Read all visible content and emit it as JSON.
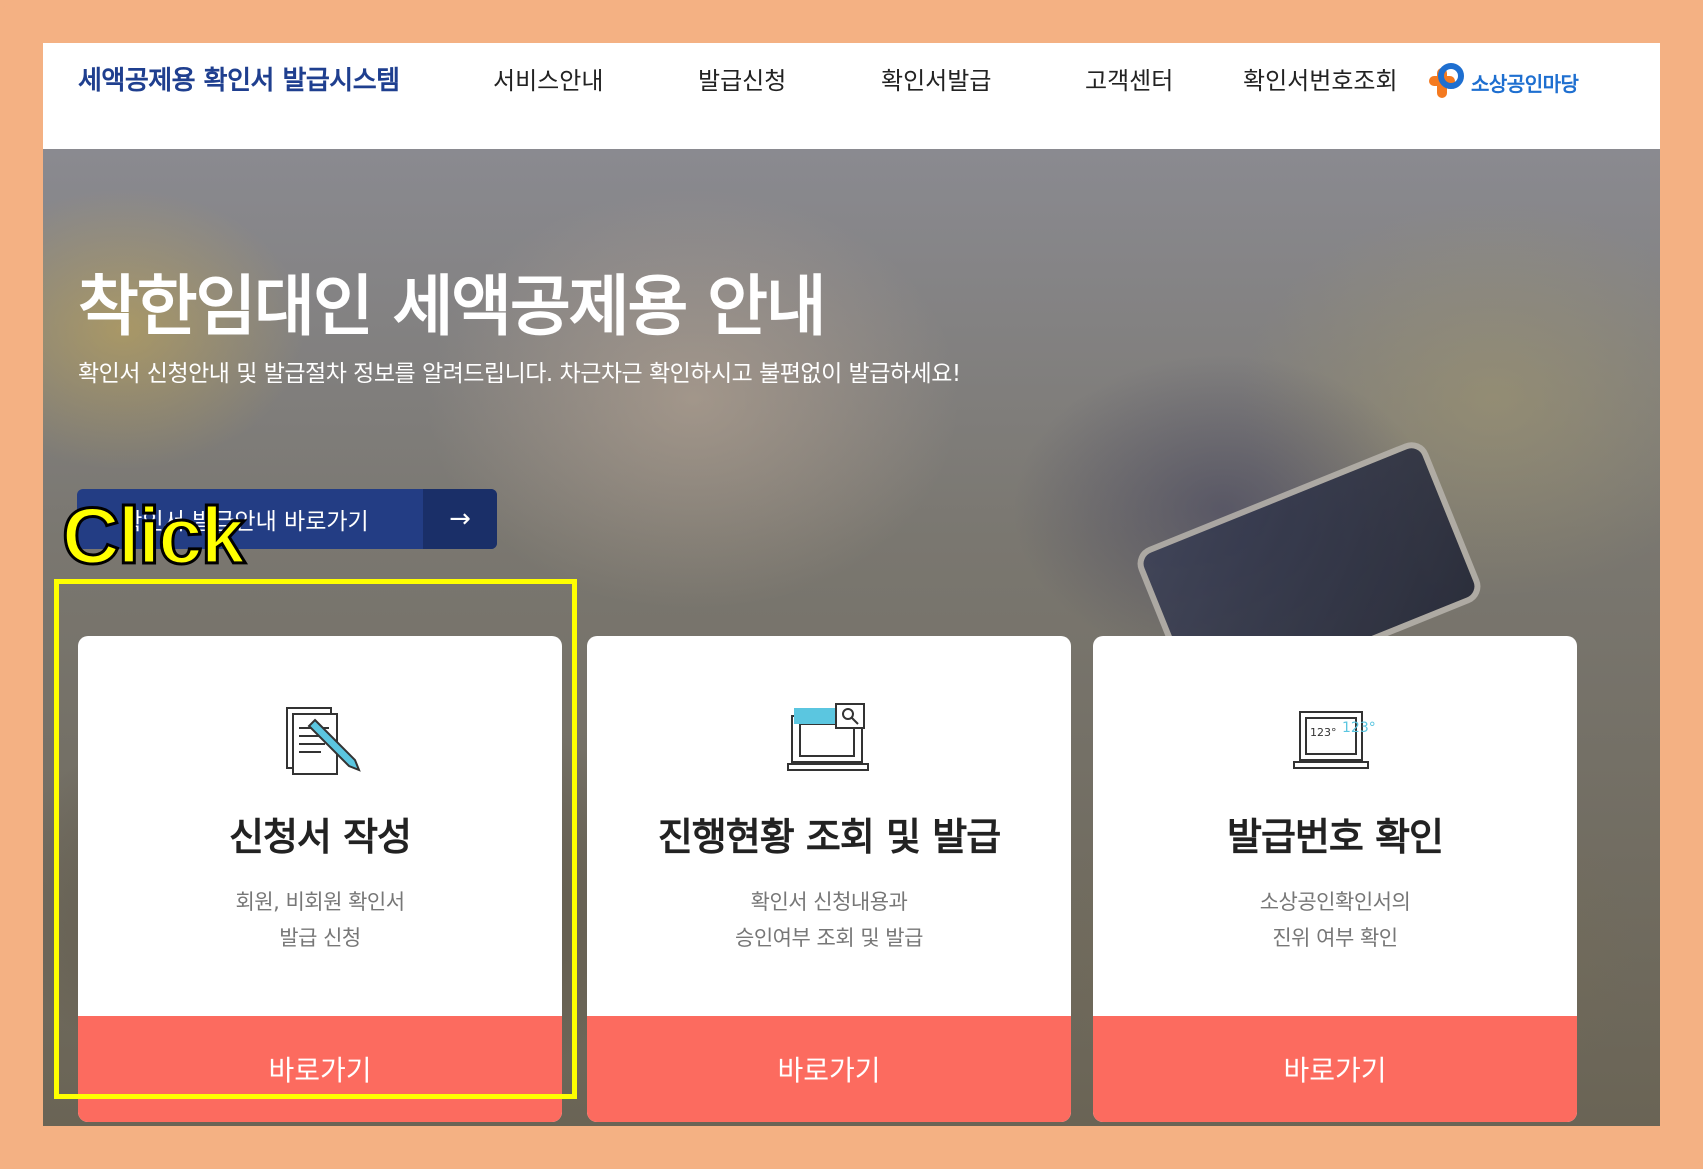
{
  "header": {
    "site_title": "세액공제용 확인서 발급시스템",
    "nav": [
      "서비스안내",
      "발급신청",
      "확인서발급",
      "고객센터",
      "확인서번호조회"
    ],
    "logo_text": "소상공인마당"
  },
  "hero": {
    "title": "착한임대인 세액공제용 안내",
    "subtitle": "확인서 신청안내 및 발급절차 정보를 알려드립니다. 차근차근 확인하시고 불편없이 발급하세요!",
    "button_label": "확인서 발급안내 바로가기",
    "button_arrow": "→"
  },
  "cards": [
    {
      "icon": "document-pencil-icon",
      "title": "신청서 작성",
      "desc_line1": "회원, 비회원 확인서",
      "desc_line2": "발급 신청",
      "button": "바로가기"
    },
    {
      "icon": "monitor-search-icon",
      "title": "진행현황 조회 및 발급",
      "desc_line1": "확인서 신청내용과",
      "desc_line2": "승인여부 조회 및 발급",
      "button": "바로가기"
    },
    {
      "icon": "laptop-number-icon",
      "title": "발급번호 확인",
      "desc_line1": "소상공인확인서의",
      "desc_line2": "진위 여부 확인",
      "button": "바로가기"
    }
  ],
  "icon_text": {
    "number": "123°",
    "number_accent": "123°"
  },
  "annotation": {
    "label": "Click"
  },
  "colors": {
    "frame": "#f4b183",
    "title_blue": "#1f3f8f",
    "hero_button": "#233d84",
    "card_button": "#fc6b5f",
    "highlight": "#ffff00"
  }
}
